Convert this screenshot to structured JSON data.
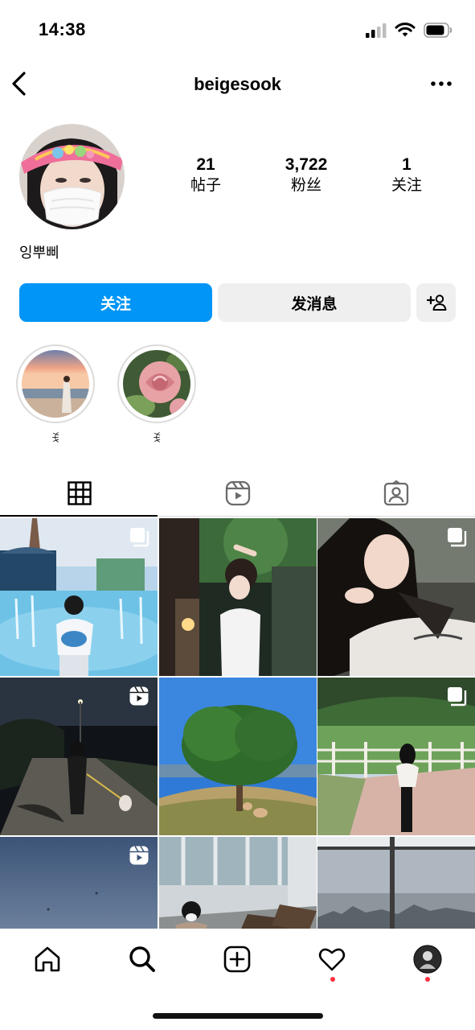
{
  "status_bar": {
    "time": "14:38",
    "icons": [
      "signal-icon",
      "wifi-icon",
      "battery-icon"
    ]
  },
  "header": {
    "username": "beigesook",
    "back_icon": "chevron-left-icon",
    "more_icon": "more-horizontal-icon"
  },
  "profile": {
    "display_name": "잉뿌삐",
    "stats": [
      {
        "value": "21",
        "label": "帖子"
      },
      {
        "value": "3,722",
        "label": "粉丝"
      },
      {
        "value": "1",
        "label": "关注"
      }
    ]
  },
  "actions": {
    "follow_label": "关注",
    "message_label": "发消息",
    "add_user_icon": "add-person-icon"
  },
  "highlights": [
    {
      "label": "ꉂ",
      "cover": "beach-sunset"
    },
    {
      "label": "ꉂ",
      "cover": "pink-rose"
    }
  ],
  "tabs": [
    {
      "icon": "grid-icon",
      "active": true
    },
    {
      "icon": "reels-icon",
      "active": false
    },
    {
      "icon": "tagged-icon",
      "active": false
    }
  ],
  "posts": [
    {
      "scene": "water-fountain-park",
      "badge": "carousel-icon"
    },
    {
      "scene": "night-terrace-pose",
      "badge": ""
    },
    {
      "scene": "selfie-hand-chin",
      "badge": "carousel-icon"
    },
    {
      "scene": "night-walk-dog",
      "badge": "reels-icon"
    },
    {
      "scene": "tree-field-dog",
      "badge": ""
    },
    {
      "scene": "fence-green-field",
      "badge": "carousel-icon"
    },
    {
      "scene": "evening-sky",
      "badge": "reels-icon"
    },
    {
      "scene": "glass-room-loungers",
      "badge": ""
    },
    {
      "scene": "window-city-view",
      "badge": ""
    }
  ],
  "bottom_nav": [
    {
      "icon": "home-icon",
      "dot": false
    },
    {
      "icon": "search-icon",
      "dot": false
    },
    {
      "icon": "create-post-icon",
      "dot": false
    },
    {
      "icon": "heart-icon",
      "dot": true
    },
    {
      "icon": "profile-avatar-icon",
      "dot": true
    }
  ],
  "colors": {
    "accent": "#0095f6",
    "notification": "#ff3040",
    "button_gray": "#efefef"
  }
}
